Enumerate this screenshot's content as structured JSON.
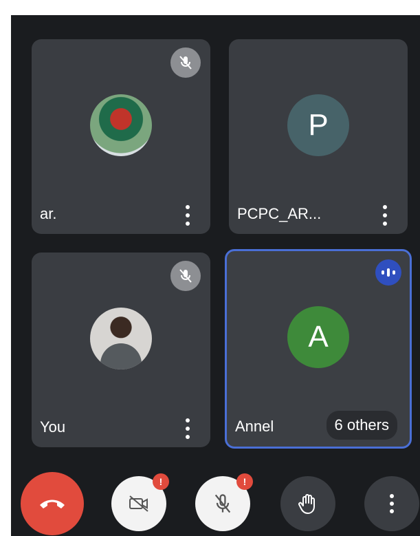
{
  "participants": [
    {
      "name": "ar.",
      "avatar_type": "photo",
      "muted": true,
      "active": false
    },
    {
      "name": "PCPC_AR...",
      "avatar_initial": "P",
      "avatar_color": "#476369",
      "muted": false,
      "active": false
    },
    {
      "name": "You",
      "avatar_type": "photo",
      "muted": true,
      "active": false
    },
    {
      "name": "Annel",
      "avatar_initial": "A",
      "avatar_color": "#3e8a3a",
      "muted": false,
      "active": true,
      "others_label": "6 others"
    }
  ],
  "controls": {
    "end_call_icon": "phone-hangup-icon",
    "camera_icon": "camera-off-icon",
    "camera_alert": "!",
    "mic_icon": "mic-off-icon",
    "mic_alert": "!",
    "hand_icon": "raise-hand-icon",
    "more_icon": "more-vertical-icon"
  },
  "colors": {
    "background": "#1a1c1f",
    "tile": "#3a3d42",
    "active_border": "#4a6fd6",
    "end_call": "#e14b3d"
  }
}
